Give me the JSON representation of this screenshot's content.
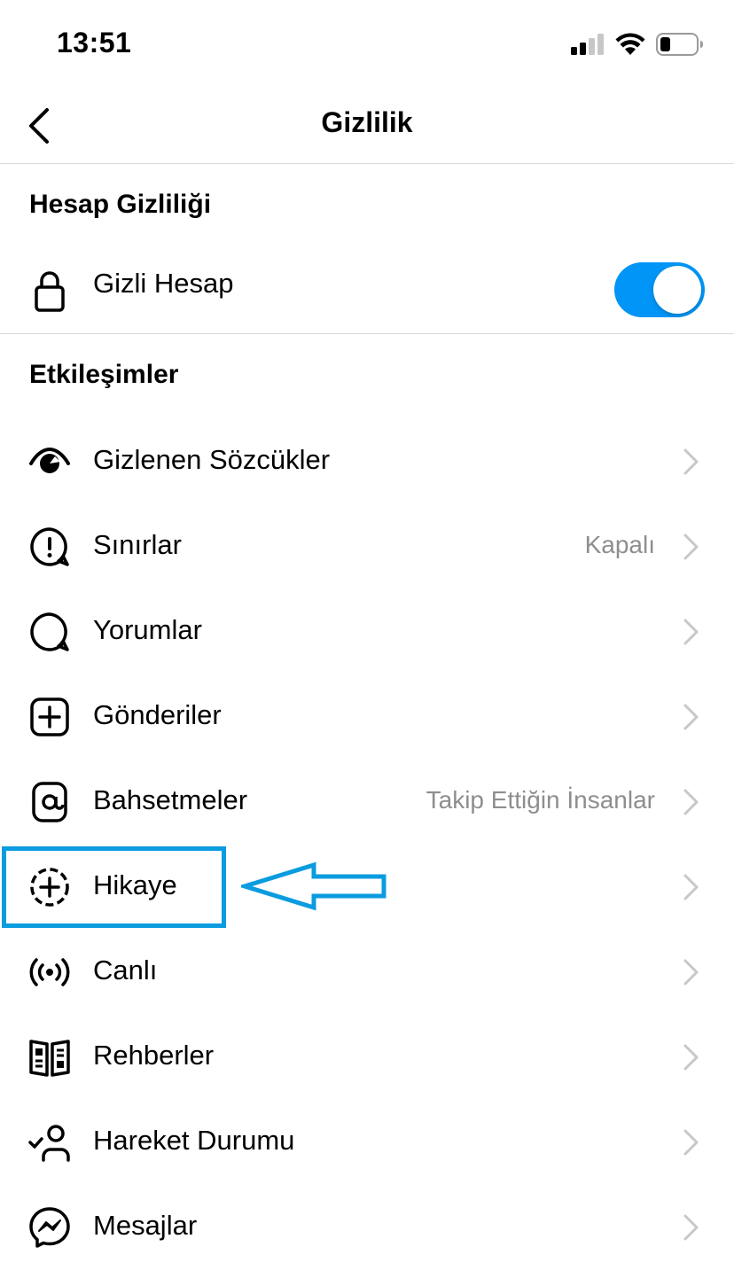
{
  "status_bar": {
    "time": "13:51"
  },
  "nav": {
    "title": "Gizlilik"
  },
  "sections": {
    "account_privacy": "Hesap Gizliliği",
    "interactions": "Etkileşimler"
  },
  "private_account": {
    "label": "Gizli Hesap",
    "enabled": true,
    "toggle_color": "#0095f6"
  },
  "items": [
    {
      "label": "Gizlenen Sözcükler",
      "value": "",
      "icon": "hidden-words-icon"
    },
    {
      "label": "Sınırlar",
      "value": "Kapalı",
      "icon": "limits-icon"
    },
    {
      "label": "Yorumlar",
      "value": "",
      "icon": "comment-icon"
    },
    {
      "label": "Gönderiler",
      "value": "",
      "icon": "post-add-icon"
    },
    {
      "label": "Bahsetmeler",
      "value": "Takip Ettiğin İnsanlar",
      "icon": "mention-icon"
    },
    {
      "label": "Hikaye",
      "value": "",
      "icon": "story-add-icon"
    },
    {
      "label": "Canlı",
      "value": "",
      "icon": "live-icon"
    },
    {
      "label": "Rehberler",
      "value": "",
      "icon": "guides-icon"
    },
    {
      "label": "Hareket Durumu",
      "value": "",
      "icon": "activity-status-icon"
    },
    {
      "label": "Mesajlar",
      "value": "",
      "icon": "messenger-icon"
    }
  ],
  "annotation": {
    "highlight_color": "#0a9cdf"
  }
}
